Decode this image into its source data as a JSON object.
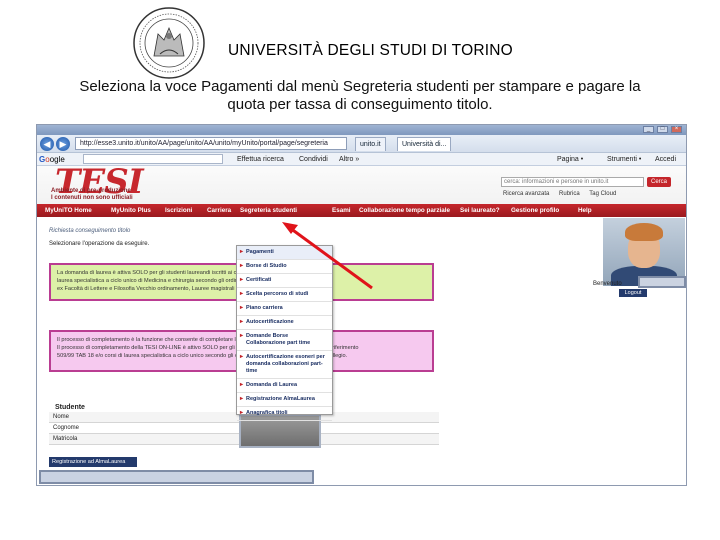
{
  "header": {
    "university": "UNIVERSITÀ DEGLI STUDI DI TORINO",
    "instruction_line1": "Seleziona la voce Pagamenti dal menù Segreteria studenti per stampare e pagare la",
    "instruction_line2": "quota per tassa di conseguimento titolo."
  },
  "browser": {
    "url": "http://esse3.unito.it/unito/AA/page/unito/AA/unito/myUnito/portal/page/segreteria",
    "tabs": [
      "unito.it",
      "Università di..."
    ],
    "google_label": "Google",
    "toolbar_items": [
      "Effettua ricerca",
      "Condividi",
      "Altro »",
      "Pagina •",
      "Strumenti •",
      "Accedi"
    ]
  },
  "site": {
    "logo_text": "TESI",
    "logo_sub1": "Ambiente di pre-produzione",
    "logo_sub2": "I contenuti non sono ufficiali",
    "search_placeholder": "cerca: informazioni e persone in unito.it",
    "search_button": "Cerca",
    "top_links": [
      "Ricerca avanzata",
      "Rubrica",
      "Tag Cloud"
    ],
    "nav": [
      "MyUniTO Home",
      "MyUnito Plus",
      "Iscrizioni",
      "Carriera",
      "Segreteria studenti",
      "Esami",
      "Collaborazione tempo parziale",
      "Sei laureato?",
      "Gestione profilo",
      "Help"
    ]
  },
  "page": {
    "breadcrumb": "Richiesta conseguimento titolo",
    "select_operation": "Selezionare l'operazione da eseguire.",
    "green_lines": [
      "La domanda di laurea è attiva SOLO per gli studenti laureandi iscritti ai corsi ex DM 3/11/99 TAB 18 e/o corsi di",
      "laurea specialistica a ciclo unico di Medicina e chirurgia secondo gli ordinamenti ex DM 509/99 e 270/04,",
      "ex Facoltà di Lettere e Filosofia Vecchio ordinamento, Lauree magistrali ex DM 509/99 e 270/04."
    ],
    "pink_lines": [
      "Il processo di completamento è la funzione che consente di completare la domanda di laurea.",
      "Il processo di completamento della TESI ON-LINE è attivo SOLO per gli studenti iscritti ai corsi di laurea aventi riferimento",
      "509/99 TAB 18 e/o corsi di laurea specialistica a ciclo unico secondo gli ordinamenti ex DM 509/99 e 270/04 Collegio."
    ],
    "student_legend": "Studente",
    "student_fields": [
      "Nome",
      "Cognome",
      "Matricola"
    ],
    "register_button": "Registrazione ad AlmaLaurea",
    "welcome": "Benvenuto",
    "logout": "Logout"
  },
  "dropdown": {
    "items": [
      "Pagamenti",
      "Borse di Studio",
      "Certificati",
      "Scelta percorso di studi",
      "Piano carriera",
      "Autocertificazione",
      "Domande Borse Collaborazione part time",
      "Autocertificazione esoneri per domanda collaborazioni part-time",
      "Domanda di Laurea",
      "Registrazione AlmaLaurea",
      "Anagrafica titoli"
    ]
  }
}
